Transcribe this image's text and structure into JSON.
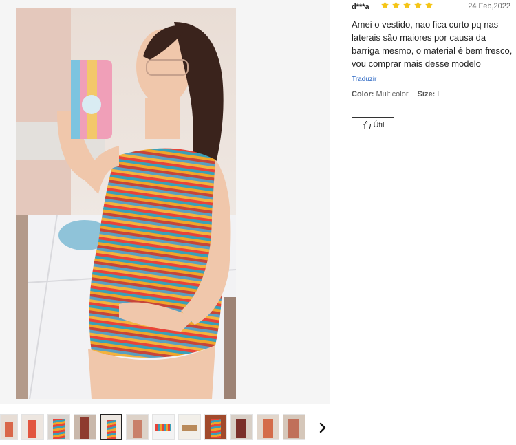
{
  "review": {
    "reviewer": "d***a",
    "rating": 5,
    "date": "24 Feb,2022",
    "text": "Amei o vestido, nao fica curto pq nas laterais são maiores por causa da barriga mesmo, o material é bem fresco, vou comprar mais desse modelo",
    "translate_label": "Traduzir",
    "color_label": "Color:",
    "color_value": "Multicolor",
    "size_label": "Size:",
    "size_value": "L",
    "helpful_label": "Útil"
  },
  "colors": {
    "star": "#f5c518",
    "stripes": [
      "#e8443a",
      "#3aa0b8",
      "#f0a52a",
      "#c7453a",
      "#5a9fc0",
      "#f3b23d"
    ]
  },
  "gallery": {
    "thumbnail_count": 12,
    "selected_index": 4,
    "next_icon": "chevron-right-icon"
  }
}
